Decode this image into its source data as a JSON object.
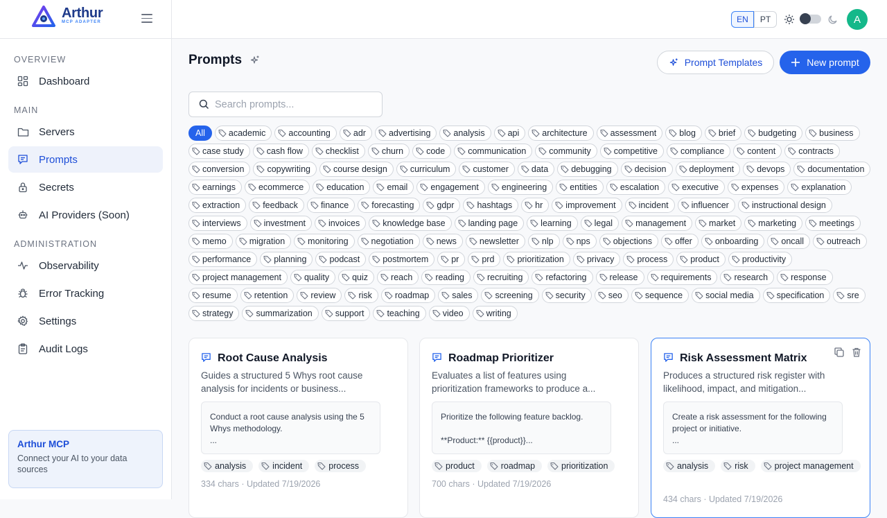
{
  "brand": {
    "name": "Arthur",
    "subtitle": "MCP ADAPTER"
  },
  "sidebar": {
    "sections": {
      "overview": "OVERVIEW",
      "main": "MAIN",
      "administration": "ADMINISTRATION"
    },
    "items": [
      {
        "label": "Dashboard",
        "icon": "dashboard-icon"
      },
      {
        "label": "Servers",
        "icon": "folder-icon"
      },
      {
        "label": "Prompts",
        "icon": "message-icon",
        "active": true
      },
      {
        "label": "Secrets",
        "icon": "lock-icon"
      },
      {
        "label": "AI Providers (Soon)",
        "icon": "robot-icon"
      },
      {
        "label": "Observability",
        "icon": "activity-icon"
      },
      {
        "label": "Error Tracking",
        "icon": "bug-icon"
      },
      {
        "label": "Settings",
        "icon": "gear-icon"
      },
      {
        "label": "Audit Logs",
        "icon": "clipboard-icon"
      }
    ],
    "promo": {
      "title": "Arthur MCP",
      "text": "Connect your AI to your data sources"
    }
  },
  "topbar": {
    "lang_en": "EN",
    "lang_pt": "PT",
    "avatar": "A"
  },
  "page": {
    "title": "Prompts",
    "templates_label": "Prompt Templates",
    "new_label": "New prompt",
    "search_placeholder": "Search prompts..."
  },
  "tags": [
    "All",
    "academic",
    "accounting",
    "adr",
    "advertising",
    "analysis",
    "api",
    "architecture",
    "assessment",
    "blog",
    "brief",
    "budgeting",
    "business",
    "case study",
    "cash flow",
    "checklist",
    "churn",
    "code",
    "communication",
    "community",
    "competitive",
    "compliance",
    "content",
    "contracts",
    "conversion",
    "copywriting",
    "course design",
    "curriculum",
    "customer",
    "data",
    "debugging",
    "decision",
    "deployment",
    "devops",
    "documentation",
    "earnings",
    "ecommerce",
    "education",
    "email",
    "engagement",
    "engineering",
    "entities",
    "escalation",
    "executive",
    "expenses",
    "explanation",
    "extraction",
    "feedback",
    "finance",
    "forecasting",
    "gdpr",
    "hashtags",
    "hr",
    "improvement",
    "incident",
    "influencer",
    "instructional design",
    "interviews",
    "investment",
    "invoices",
    "knowledge base",
    "landing page",
    "learning",
    "legal",
    "management",
    "market",
    "marketing",
    "meetings",
    "memo",
    "migration",
    "monitoring",
    "negotiation",
    "news",
    "newsletter",
    "nlp",
    "nps",
    "objections",
    "offer",
    "onboarding",
    "oncall",
    "outreach",
    "performance",
    "planning",
    "podcast",
    "postmortem",
    "pr",
    "prd",
    "prioritization",
    "privacy",
    "process",
    "product",
    "productivity",
    "project management",
    "quality",
    "quiz",
    "reach",
    "reading",
    "recruiting",
    "refactoring",
    "release",
    "requirements",
    "research",
    "response",
    "resume",
    "retention",
    "review",
    "risk",
    "roadmap",
    "sales",
    "screening",
    "security",
    "seo",
    "sequence",
    "social media",
    "specification",
    "sre",
    "strategy",
    "summarization",
    "support",
    "teaching",
    "video",
    "writing"
  ],
  "cards": [
    {
      "title": "Root Cause Analysis",
      "description": "Guides a structured 5 Whys root cause analysis for incidents or business...",
      "preview": "Conduct a root cause analysis using the 5 Whys methodology.\n...",
      "tags": [
        "analysis",
        "incident",
        "process"
      ],
      "meta": "334 chars · Updated 7/19/2026"
    },
    {
      "title": "Roadmap Prioritizer",
      "description": "Evaluates a list of features using prioritization frameworks to produce a...",
      "preview": "Prioritize the following feature backlog.\n\n**Product:** {{product}}...",
      "tags": [
        "product",
        "roadmap",
        "prioritization"
      ],
      "meta": "700 chars · Updated 7/19/2026"
    },
    {
      "title": "Risk Assessment Matrix",
      "description": "Produces a structured risk register with likelihood, impact, and mitigation...",
      "preview": "Create a risk assessment for the following project or initiative.\n...",
      "tags": [
        "analysis",
        "risk",
        "project management"
      ],
      "meta": "434 chars · Updated 7/19/2026"
    }
  ],
  "colors": {
    "accent": "#2563eb",
    "avatar": "#14b88a",
    "active_bg": "#eef2fb"
  }
}
